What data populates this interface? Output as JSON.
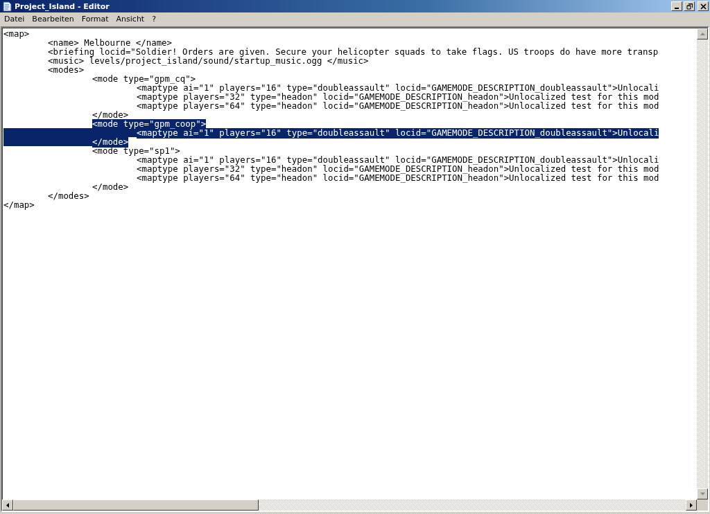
{
  "window": {
    "title": "Project_Island - Editor"
  },
  "menu": [
    {
      "label": "Datei"
    },
    {
      "label": "Bearbeiten"
    },
    {
      "label": "Format"
    },
    {
      "label": "Ansicht"
    },
    {
      "label": "?"
    }
  ],
  "lines": [
    {
      "text": "<map>",
      "selected": false,
      "children": [
        {
          "text": "<name> Melbourne </name>",
          "selected": false
        },
        {
          "text": "<briefing locid=\"Soldier! Orders are given. Secure your helicopter squads to take flags. US troops do have more transp",
          "selected": false
        },
        {
          "text": "<music> levels/project_island/sound/startup_music.ogg </music>",
          "selected": false
        },
        {
          "text": "<modes>",
          "selected": false,
          "children": [
            {
              "text": "<mode type=\"gpm_cq\">",
              "selected": false,
              "children": [
                {
                  "text": "<maptype ai=\"1\" players=\"16\" type=\"doubleassault\" locid=\"GAMEMODE_DESCRIPTION_doubleassault\">Unlocali",
                  "selected": false
                },
                {
                  "text": "<maptype players=\"32\" type=\"headon\" locid=\"GAMEMODE_DESCRIPTION_headon\">Unlocalized test for this mod",
                  "selected": false
                },
                {
                  "text": "<maptype players=\"64\" type=\"headon\" locid=\"GAMEMODE_DESCRIPTION_headon\">Unlocalized test for this mod",
                  "selected": false
                }
              ]
            },
            {
              "text": "</mode>",
              "selected": false
            },
            {
              "text": "<mode type=\"gpm_coop\">",
              "selected": true,
              "children": [
                {
                  "text": "<maptype ai=\"1\" players=\"16\" type=\"doubleassault\" locid=\"GAMEMODE_DESCRIPTION_doubleassault\">Unlocali",
                  "selected": true
                }
              ]
            },
            {
              "text": "</mode>",
              "selected": true
            },
            {
              "text": "<mode type=\"sp1\">",
              "selected": false,
              "children": [
                {
                  "text": "<maptype ai=\"1\" players=\"16\" type=\"doubleassault\" locid=\"GAMEMODE_DESCRIPTION_doubleassault\">Unlocali",
                  "selected": false
                },
                {
                  "text": "<maptype players=\"32\" type=\"headon\" locid=\"GAMEMODE_DESCRIPTION_headon\">Unlocalized test for this mod",
                  "selected": false
                },
                {
                  "text": "<maptype players=\"64\" type=\"headon\" locid=\"GAMEMODE_DESCRIPTION_headon\">Unlocalized test for this mod",
                  "selected": false
                }
              ]
            },
            {
              "text": "</mode>",
              "selected": false
            }
          ]
        },
        {
          "text": "</modes>",
          "selected": false
        }
      ]
    },
    {
      "text": "</map>",
      "selected": false
    }
  ]
}
